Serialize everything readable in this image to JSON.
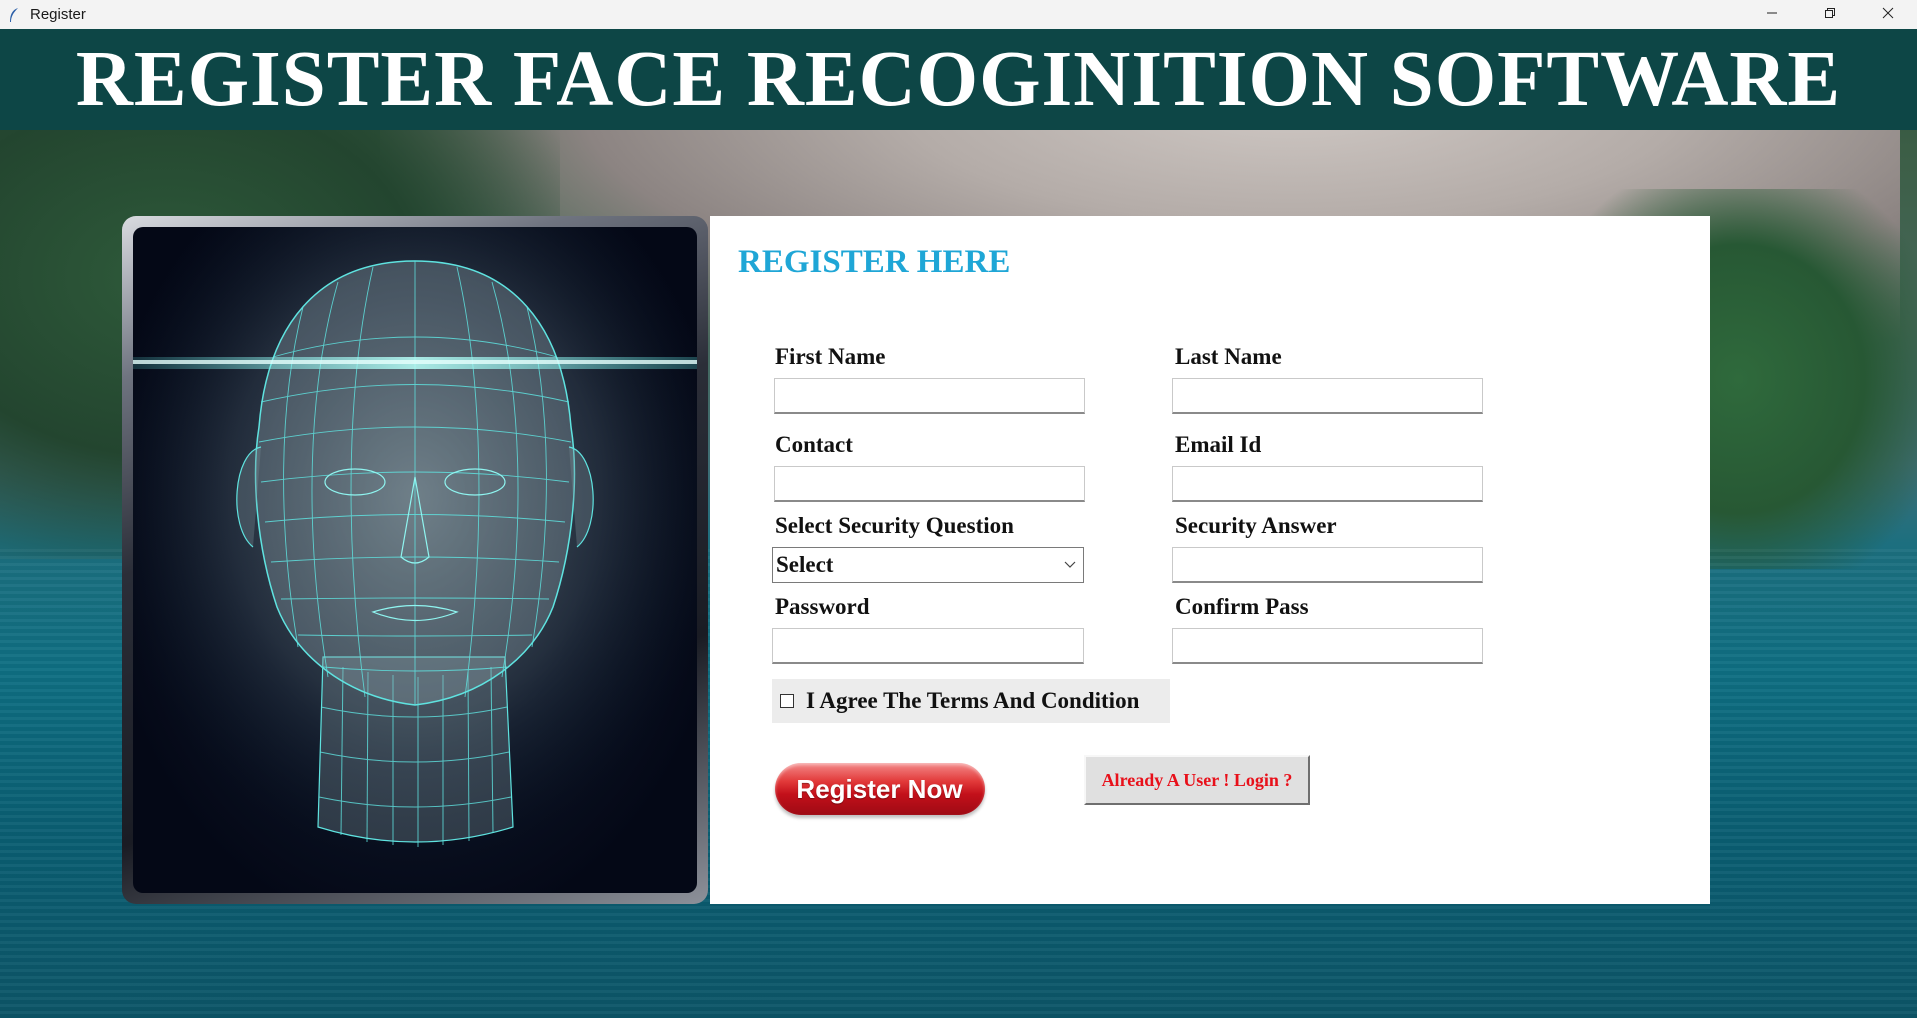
{
  "window": {
    "title": "Register",
    "controls": [
      "minimize-icon",
      "restore-icon",
      "close-icon"
    ]
  },
  "banner": {
    "title": "REGISTER FACE RECOGINITION SOFTWARE"
  },
  "form": {
    "heading": "REGISTER HERE",
    "fields": {
      "first_name": {
        "label": "First Name",
        "value": ""
      },
      "last_name": {
        "label": "Last Name",
        "value": ""
      },
      "contact": {
        "label": "Contact",
        "value": ""
      },
      "email": {
        "label": "Email Id",
        "value": ""
      },
      "security_question": {
        "label": "Select Security Question",
        "selected": "Select"
      },
      "security_answer": {
        "label": "Security Answer",
        "value": ""
      },
      "password": {
        "label": "Password",
        "value": ""
      },
      "confirm_password": {
        "label": "Confirm Pass",
        "value": ""
      }
    },
    "terms": {
      "label": "I Agree The Terms And Condition",
      "checked": false
    },
    "register_button": "Register Now",
    "login_button": "Already A User ! Login ?"
  },
  "colors": {
    "banner_bg": "#0d4646",
    "heading": "#1fa6d6",
    "login_text": "#e8101a",
    "register_btn": "#d4202a",
    "face_mesh": "#5fe3e0"
  }
}
